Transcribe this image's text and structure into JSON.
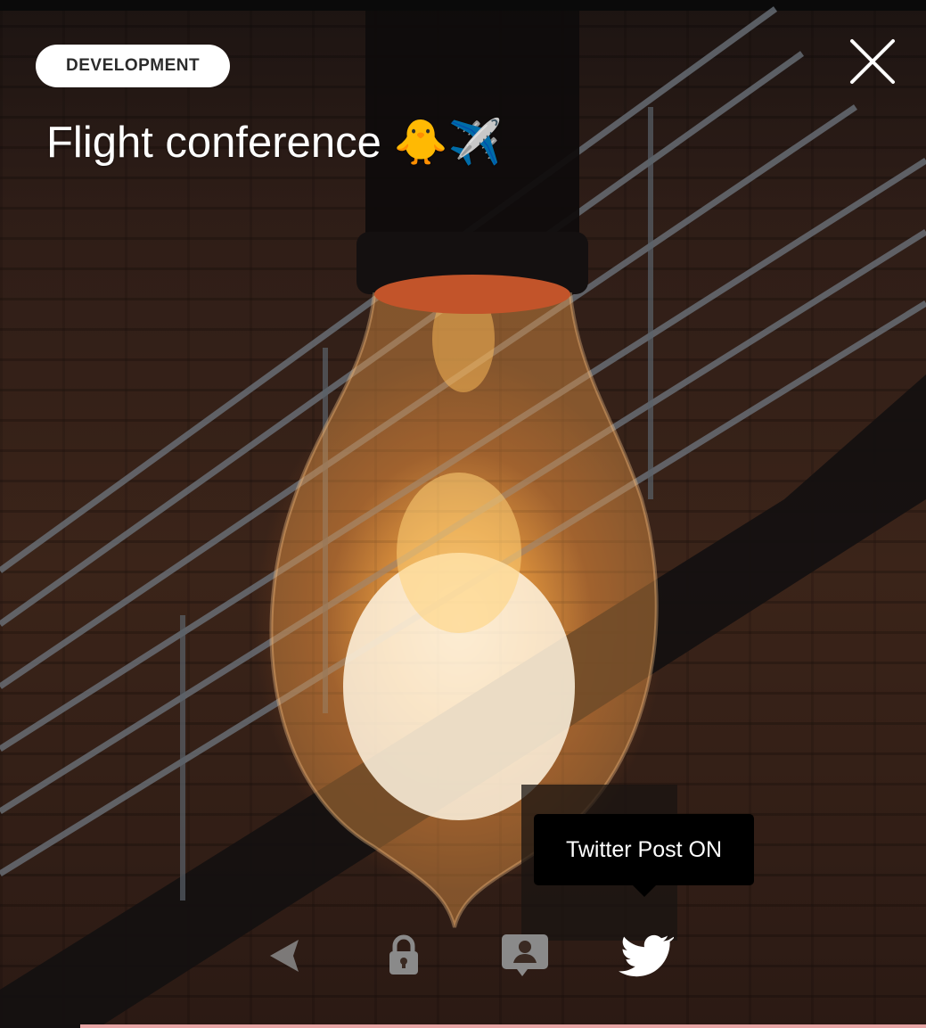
{
  "story": {
    "category": "DEVELOPMENT",
    "title": "Flight conference 🐥✈️"
  },
  "tooltip": {
    "text": "Twitter Post ON"
  },
  "icons": {
    "close": "close-icon",
    "back": "back-arrow-icon",
    "lock": "lock-icon",
    "profile": "profile-card-icon",
    "twitter": "twitter-bird-icon"
  },
  "colors": {
    "badge_bg": "#ffffff",
    "badge_text": "#2b2b2b",
    "tooltip_bg": "#000000",
    "icon_dim": "#8a8a8a",
    "icon_active": "#ffffff",
    "accent_line": "#e7a5a5"
  }
}
